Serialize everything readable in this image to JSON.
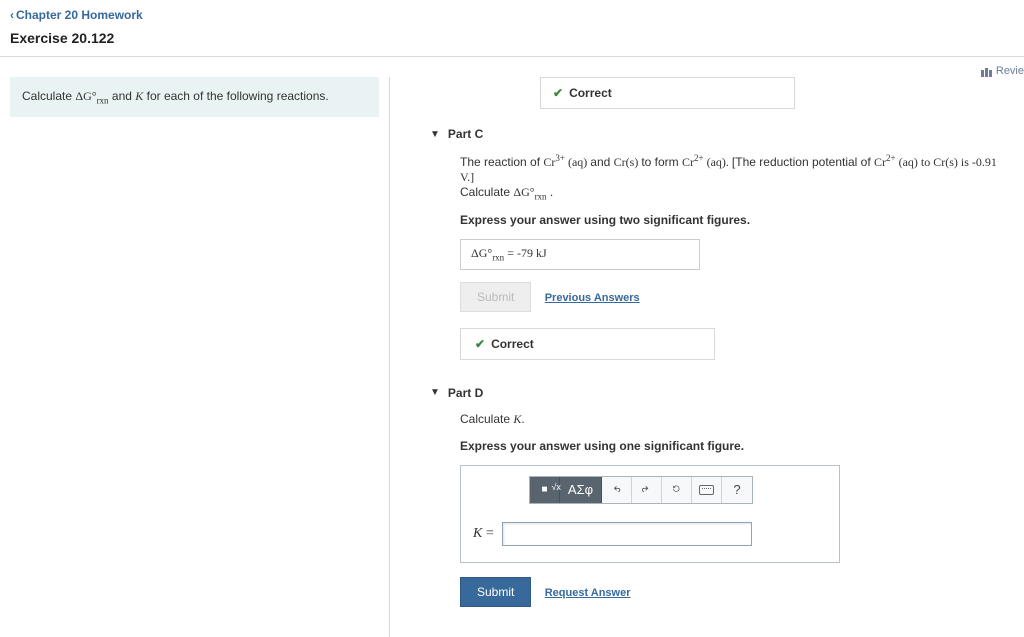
{
  "nav": {
    "back_label": "Chapter 20 Homework"
  },
  "exercise_title": "Exercise 20.122",
  "review_label": "Revie",
  "intro": {
    "calc_prefix": "Calculate ",
    "delta_g": "ΔG°",
    "delta_g_sub": "rxn",
    "and": " and ",
    "k_var": "K",
    "suffix": " for each of the following reactions."
  },
  "top_correct": {
    "label": "Correct"
  },
  "partC": {
    "header": "Part C",
    "line1a": "The reaction of ",
    "cr3": "Cr",
    "cr3_sup": "3+",
    "aq1": " (aq) ",
    "and_word": "and ",
    "crs": "Cr(s) ",
    "toform": "to form ",
    "cr2": "Cr",
    "cr2_sup": "2+",
    "aq2": " (aq). ",
    "bracket_open": "[The reduction potential of ",
    "cr2b": "Cr",
    "cr2b_sup": "2+",
    "aq3": " (aq) ",
    "to_crs": "to Cr(s) is -0.91 V.]",
    "line2_prefix": "Calculate ",
    "line2_dg": "ΔG°",
    "line2_sub": "rxn",
    "line2_period": " .",
    "instruction": "Express your answer using two significant figures.",
    "answer_dg": "ΔG°",
    "answer_sub": "rxn",
    "answer_eq": " = ",
    "answer_val": "-79",
    "answer_unit": " kJ",
    "submit_label": "Submit",
    "prev_answers": "Previous Answers",
    "correct_label": "Correct"
  },
  "partD": {
    "header": "Part D",
    "line1_prefix": "Calculate ",
    "k_var": "K",
    "line1_period": ".",
    "instruction": "Express your answer using one significant figure.",
    "toolbar": {
      "templates": "√x",
      "greek": "ΑΣφ",
      "undo_title": "undo",
      "redo_title": "redo",
      "reset_title": "reset",
      "keyboard_title": "keyboard",
      "help": "?"
    },
    "var_label": "K",
    "equals": " = ",
    "input_placeholder": "",
    "submit_label": "Submit",
    "request_answer": "Request Answer"
  }
}
